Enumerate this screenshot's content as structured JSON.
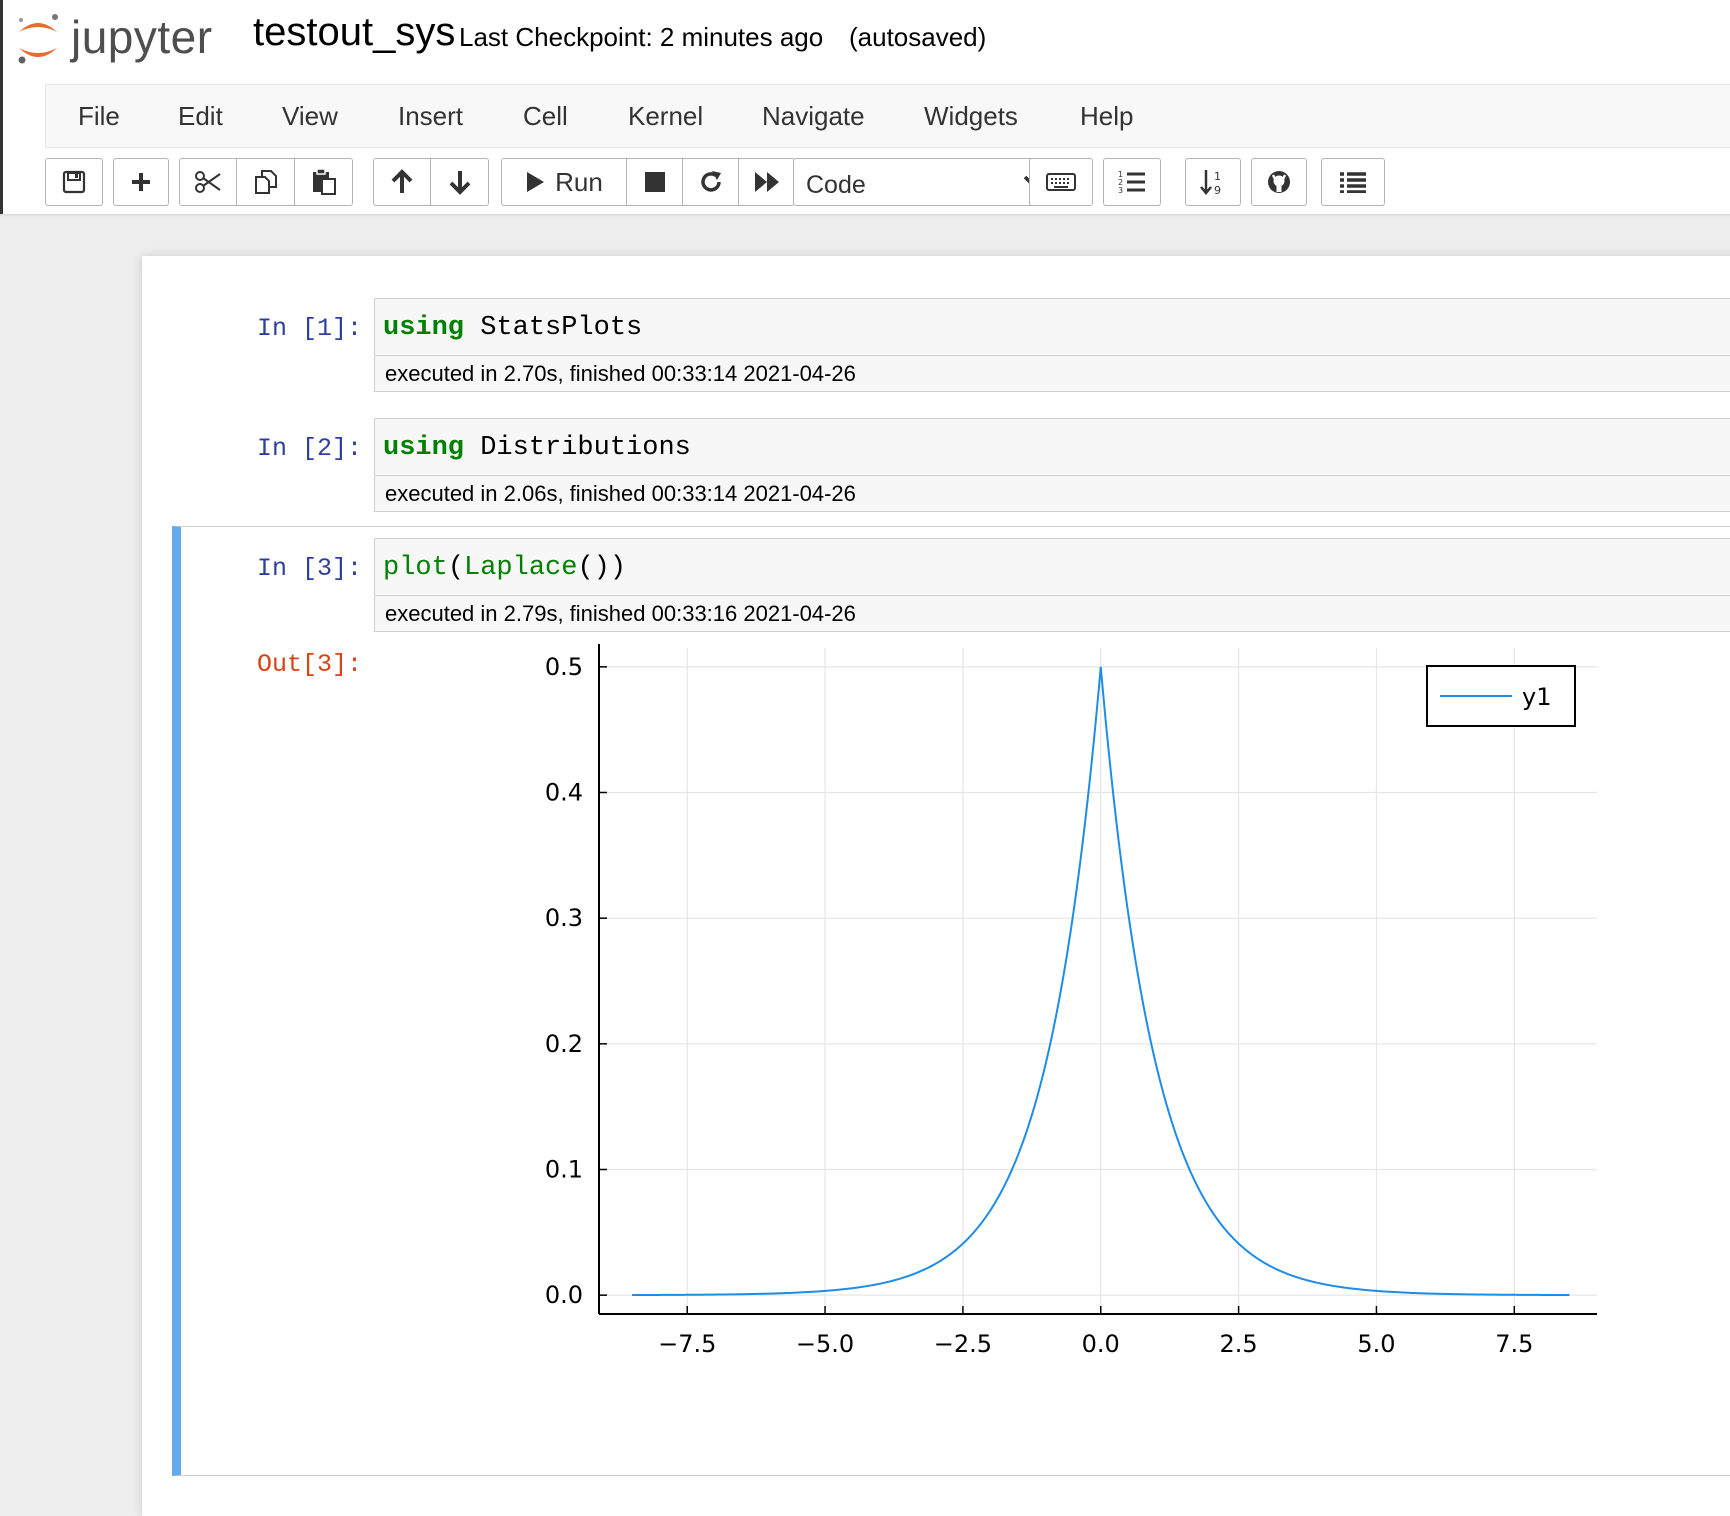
{
  "header": {
    "logo_text": "jupyter",
    "notebook_name": "testout_sys",
    "checkpoint": "Last Checkpoint: 2 minutes ago",
    "autosave": "(autosaved)"
  },
  "menu": [
    "File",
    "Edit",
    "View",
    "Insert",
    "Cell",
    "Kernel",
    "Navigate",
    "Widgets",
    "Help"
  ],
  "toolbar": {
    "run_label": "Run",
    "cell_type": "Code",
    "icons": [
      "save-icon",
      "plus-icon",
      "scissors-icon",
      "copy-icon",
      "paste-icon",
      "arrow-up-icon",
      "arrow-down-icon",
      "play-icon",
      "stop-icon",
      "restart-icon",
      "fast-forward-icon",
      "keyboard-icon",
      "numbered-list-icon",
      "sort-numeric-icon",
      "github-icon",
      "list-icon"
    ]
  },
  "cells": [
    {
      "prompt": "In [1]:",
      "keyword": "using",
      "rest": " StatsPlots",
      "exec": "executed in 2.70s, finished 00:33:14 2021-04-26"
    },
    {
      "prompt": "In [2]:",
      "keyword": "using",
      "rest": " Distributions",
      "exec": "executed in 2.06s, finished 00:33:14 2021-04-26"
    },
    {
      "prompt": "In [3]:",
      "func": "plot",
      "p1": "(",
      "arg": "Laplace",
      "p2": "())",
      "exec": "executed in 2.79s, finished 00:33:16 2021-04-26"
    }
  ],
  "output_prompt": "Out[3]:",
  "chart_data": {
    "type": "line",
    "series": [
      {
        "name": "y1",
        "color": "#1f8ce6",
        "function": "laplace_pdf",
        "x_range": [
          -8.5,
          8.5
        ]
      }
    ],
    "xlim": [
      -9.1,
      9.0
    ],
    "ylim": [
      -0.015,
      0.515
    ],
    "x_ticks": [
      -7.5,
      -5.0,
      -2.5,
      0.0,
      2.5,
      5.0,
      7.5
    ],
    "x_tick_labels": [
      "−7.5",
      "−5.0",
      "−2.5",
      "0.0",
      "2.5",
      "5.0",
      "7.5"
    ],
    "y_ticks": [
      0.0,
      0.1,
      0.2,
      0.3,
      0.4,
      0.5
    ],
    "y_tick_labels": [
      "0.0",
      "0.1",
      "0.2",
      "0.3",
      "0.4",
      "0.5"
    ],
    "grid": true,
    "legend": "top-right"
  }
}
